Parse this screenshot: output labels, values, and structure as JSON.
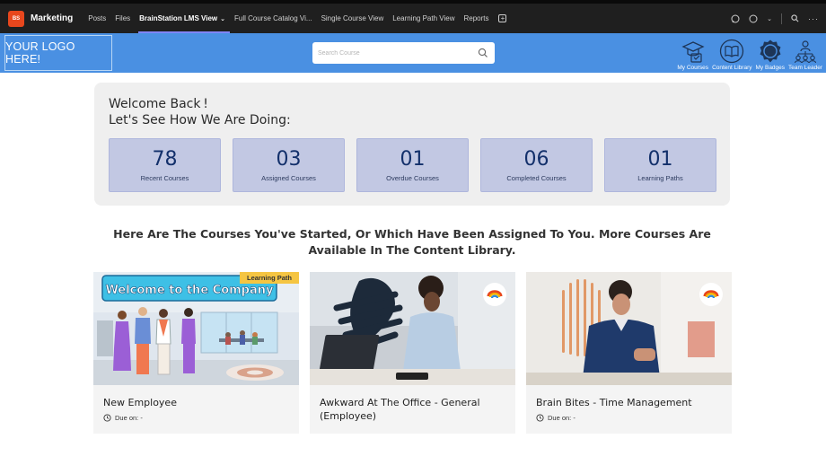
{
  "teams_bar": {
    "team_initials": "BS",
    "team_name": "Marketing",
    "tabs": [
      {
        "label": "Posts"
      },
      {
        "label": "Files"
      },
      {
        "label": "BrainStation LMS View"
      },
      {
        "label": "Full Course Catalog Vi..."
      },
      {
        "label": "Single Course View"
      },
      {
        "label": "Learning Path View"
      },
      {
        "label": "Reports"
      }
    ],
    "add_tab_glyph": "+"
  },
  "header": {
    "logo_text": "YOUR LOGO HERE!",
    "search_placeholder": "Search Course",
    "nav": [
      {
        "label": "My Courses",
        "icon": "graduation-cap-icon"
      },
      {
        "label": "Content Library",
        "icon": "book-icon"
      },
      {
        "label": "My Badges",
        "icon": "badge-icon"
      },
      {
        "label": "Team Leader",
        "icon": "team-icon"
      }
    ],
    "accent_color": "#4a90e2"
  },
  "welcome": {
    "line1": "Welcome Back !",
    "line2": "Let's See How We Are Doing:",
    "stats": [
      {
        "value": "78",
        "label": "Recent Courses"
      },
      {
        "value": "03",
        "label": "Assigned Courses"
      },
      {
        "value": "01",
        "label": "Overdue Courses"
      },
      {
        "value": "06",
        "label": "Completed Courses"
      },
      {
        "value": "01",
        "label": "Learning Paths"
      }
    ]
  },
  "message": "Here Are The Courses You've Started, Or Which Have Been Assigned To You. More Courses Are Available In The Content Library.",
  "courses": [
    {
      "title": "New Employee",
      "badge": "Learning Path",
      "banner": "Welcome to the Company",
      "due": "Due on: -"
    },
    {
      "title": "Awkward At The Office - General (Employee)",
      "due": ""
    },
    {
      "title": "Brain Bites - Time Management",
      "due": "Due on: -"
    }
  ]
}
